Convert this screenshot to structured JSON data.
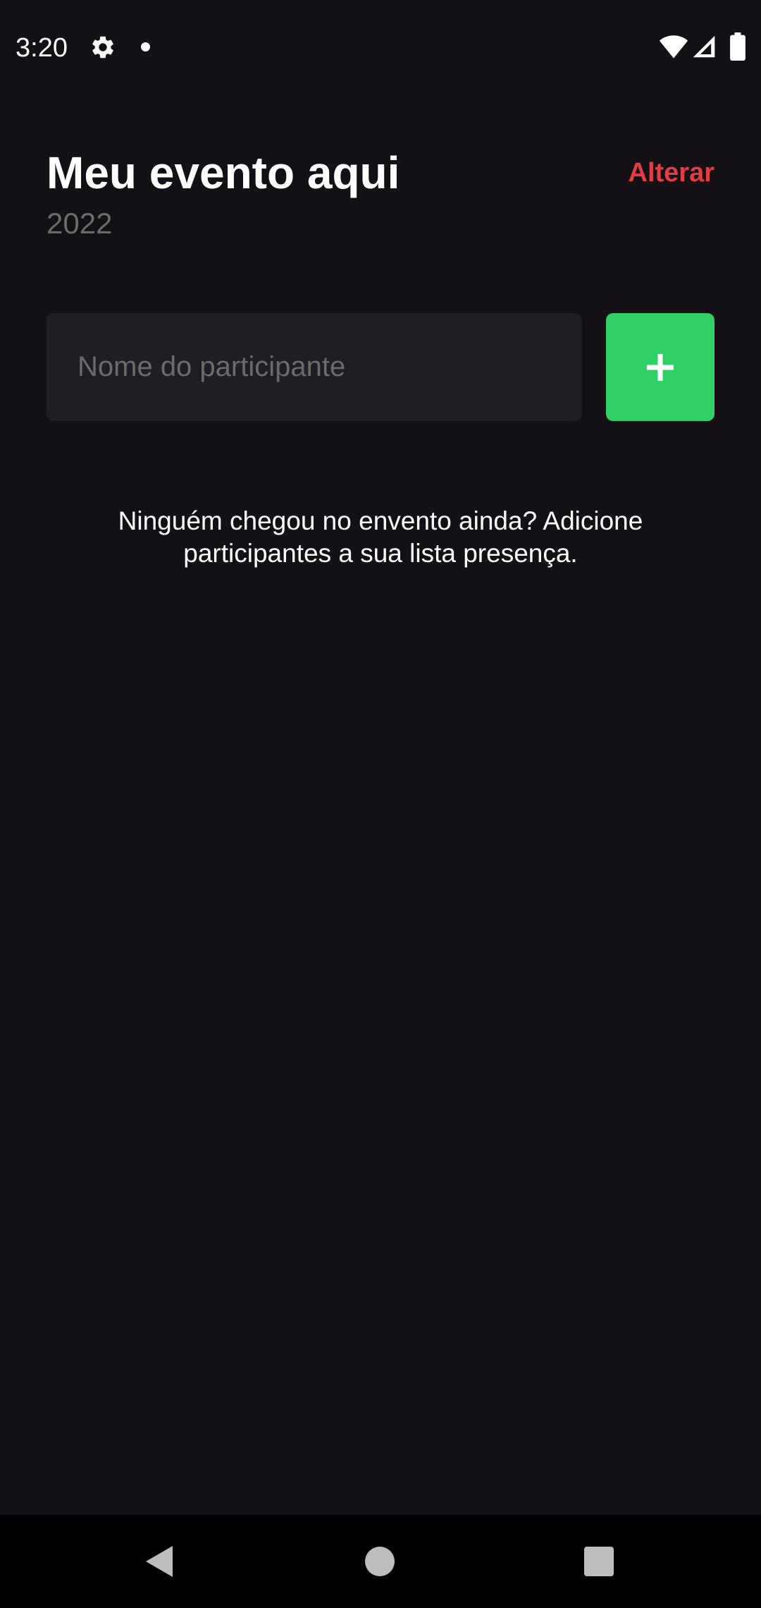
{
  "status_bar": {
    "time": "3:20",
    "icons": [
      "gear-icon",
      "notification-dot-icon",
      "wifi-icon",
      "signal-icon",
      "battery-icon"
    ]
  },
  "header": {
    "title": "Meu evento aqui",
    "date": "2022",
    "change_label": "Alterar"
  },
  "form": {
    "input_placeholder": "Nome do participante",
    "input_value": "",
    "add_button_icon": "plus-icon"
  },
  "empty_state": {
    "message": "Ninguém chegou no envento ainda? Adicione participantes a sua lista presença."
  },
  "nav_bar": {
    "icons": [
      "back-icon",
      "home-icon",
      "recents-icon"
    ]
  },
  "colors": {
    "background": "#131016",
    "input_background": "#1f1e25",
    "accent_green": "#31cf67",
    "accent_red": "#e23c44",
    "muted_text": "#6b6b6b"
  }
}
